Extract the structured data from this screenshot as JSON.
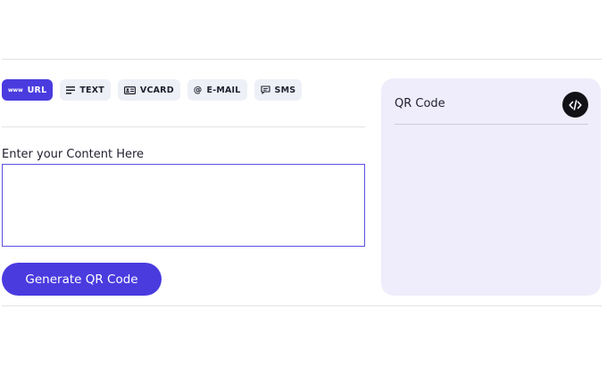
{
  "tabs": [
    {
      "id": "url",
      "label": "URL",
      "icon": "www-icon",
      "active": true
    },
    {
      "id": "text",
      "label": "TEXT",
      "icon": "text-lines-icon",
      "active": false
    },
    {
      "id": "vcard",
      "label": "VCARD",
      "icon": "id-card-icon",
      "active": false
    },
    {
      "id": "email",
      "label": "E-MAIL",
      "icon": "at-sign-icon",
      "active": false
    },
    {
      "id": "sms",
      "label": "SMS",
      "icon": "message-icon",
      "active": false
    }
  ],
  "url_icon_glyph": "www",
  "email_icon_glyph": "@",
  "content": {
    "label": "Enter your Content Here",
    "value": "",
    "placeholder": ""
  },
  "generate_button": {
    "label": "Generate QR Code"
  },
  "qr_panel": {
    "title": "QR Code",
    "embed_icon": "code-embed-icon"
  },
  "colors": {
    "accent": "#4a3bdf",
    "tab_bg": "#eef0f7",
    "panel_bg": "#efedfb",
    "input_border": "#5b4fe0"
  }
}
